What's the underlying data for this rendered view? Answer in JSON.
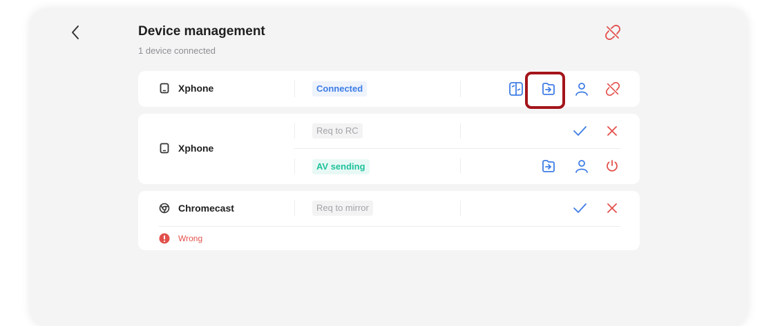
{
  "header": {
    "title": "Device management",
    "subtitle": "1 device connected",
    "back_icon": "chevron-left-icon",
    "disconnect_all_icon": "link-off-icon"
  },
  "devices": [
    {
      "name": "Xphone",
      "icon": "phone-icon",
      "status": "Connected",
      "actions": [
        "screen-share-icon",
        "file-send-icon",
        "user-icon",
        "link-off-icon"
      ]
    },
    {
      "name": "Xphone",
      "icon": "phone-icon",
      "requests": [
        {
          "status": "Req to RC",
          "actions": [
            "check-icon",
            "close-icon"
          ]
        },
        {
          "status": "AV sending",
          "actions": [
            "file-send-icon",
            "user-icon",
            "power-icon"
          ]
        }
      ]
    },
    {
      "name": "Chromecast",
      "icon": "chrome-icon",
      "status": "Req to mirror",
      "actions": [
        "check-icon",
        "close-icon"
      ],
      "error": "Wrong"
    }
  ],
  "colors": {
    "accent_blue": "#3d7ce6",
    "danger_red": "#e3504b",
    "success_green": "#1fc29c",
    "highlight": "#a3151b"
  }
}
